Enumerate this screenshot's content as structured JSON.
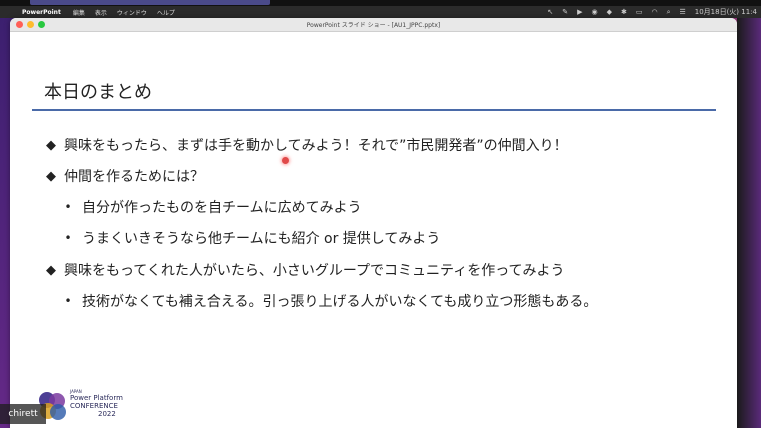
{
  "menubar": {
    "app_name": "PowerPoint",
    "items": [
      "編集",
      "表示",
      "ウィンドウ",
      "ヘルプ"
    ],
    "clock": "10月18日(火) 11:4"
  },
  "window": {
    "title": "PowerPoint スライド ショー - [AU1_JPPC.pptx]"
  },
  "slide": {
    "title": "本日のまとめ",
    "bullets": [
      {
        "level": 1,
        "marker": "◆",
        "text": "興味をもったら、まずは手を動かしてみよう！それで”市民開発者”の仲間入り！"
      },
      {
        "level": 1,
        "marker": "◆",
        "text": "仲間を作るためには？"
      },
      {
        "level": 2,
        "marker": "•",
        "text": "自分が作ったものを自チームに広めてみよう"
      },
      {
        "level": 2,
        "marker": "•",
        "text": "うまくいきそうなら他チームにも紹介 or 提供してみよう"
      },
      {
        "level": 1,
        "marker": "◆",
        "text": "興味をもってくれた人がいたら、小さいグループでコミュニティを作ってみよう"
      },
      {
        "level": 2,
        "marker": "•",
        "text": "技術がなくても補え合える。引っ張り上げる人がいなくても成り立つ形態もある。"
      }
    ],
    "logo": {
      "line1": "JAPAN",
      "line2": "Power Platform",
      "line3": "CONFERENCE",
      "line4": "2022"
    }
  },
  "participant": {
    "name": "chirett"
  },
  "colors": {
    "title_rule": "#4a6aa8",
    "laser": "#e04a4a"
  }
}
